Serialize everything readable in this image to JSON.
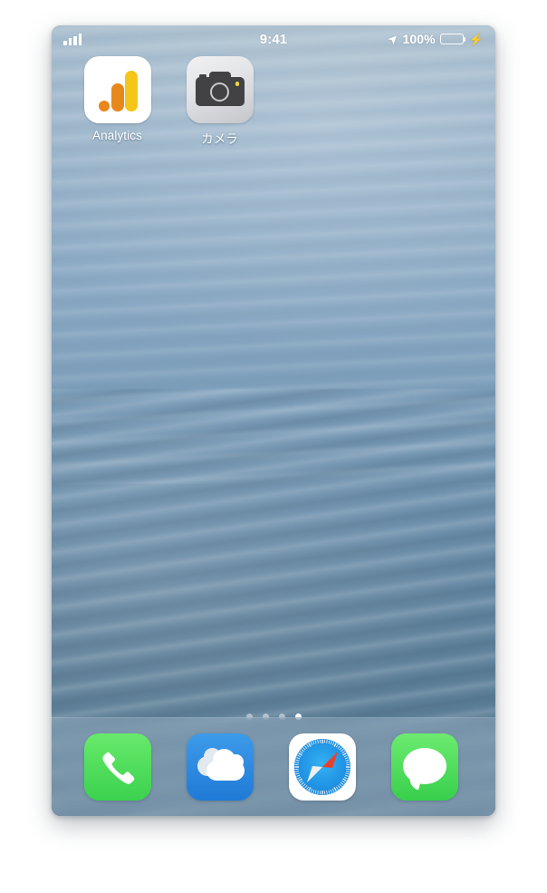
{
  "device": {
    "platform": "ios-home-screen",
    "screen_label": "iPhone Home Screen"
  },
  "status_bar": {
    "signal_icon": "signal-bars-icon",
    "signal_bars_filled": 4,
    "signal_bars_total": 4,
    "time": "9:41",
    "location_icon": "location-arrow-icon",
    "location_glyph": "➤",
    "battery_percent": "100%",
    "battery_level": 100,
    "battery_icon": "battery-icon",
    "battery_color": "#4cd964",
    "charging": true,
    "charging_icon": "lightning-bolt-icon",
    "charging_glyph": "⚡"
  },
  "home_screen": {
    "apps": [
      {
        "label": "Analytics",
        "icon_name": "google-analytics-icon",
        "colors": {
          "background": "#ffffff",
          "bar_tall": "#f5c518",
          "bar_mid": "#e8871a",
          "dot": "#e8871a"
        }
      },
      {
        "label": "カメラ",
        "icon_name": "camera-icon",
        "colors": {
          "background": "#e3e4e7",
          "body": "#424244",
          "flash": "#f2d53c"
        }
      }
    ],
    "page_dots": {
      "total": 4,
      "active_index": 3
    }
  },
  "dock": {
    "apps": [
      {
        "label": "Phone",
        "icon_name": "phone-icon",
        "color": "#3bd14e"
      },
      {
        "label": "Weather",
        "icon_name": "weather-icon",
        "color": "#1f7ad6"
      },
      {
        "label": "Safari",
        "icon_name": "safari-compass-icon",
        "color": "#1f91e3"
      },
      {
        "label": "Messages",
        "icon_name": "messages-icon",
        "color": "#38cf4c"
      }
    ]
  },
  "wallpaper": {
    "name": "water-ripples-wallpaper",
    "top_color": "#a9bece",
    "bottom_color": "#587890"
  }
}
